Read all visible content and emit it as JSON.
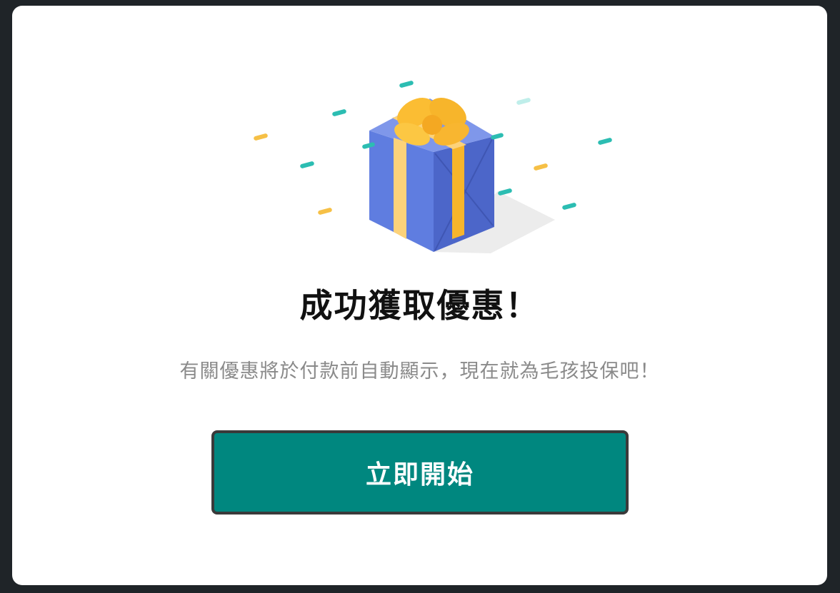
{
  "dialog": {
    "title": "成功獲取優惠！",
    "message": "有關優惠將於付款前自動顯示，現在就為毛孩投保吧！",
    "primary_button": "立即開始"
  },
  "illustration": {
    "icon": "gift-box-icon",
    "colors": {
      "box": "#5b78dc",
      "box_side": "#4c66c9",
      "ribbon": "#fbbd33",
      "confetti_teal": "#2cbdb2",
      "confetti_yellow": "#f6c046"
    }
  },
  "colors": {
    "overlay": "#1f2428",
    "button": "#00877f",
    "title": "#111111",
    "message": "#8a8a8a"
  }
}
